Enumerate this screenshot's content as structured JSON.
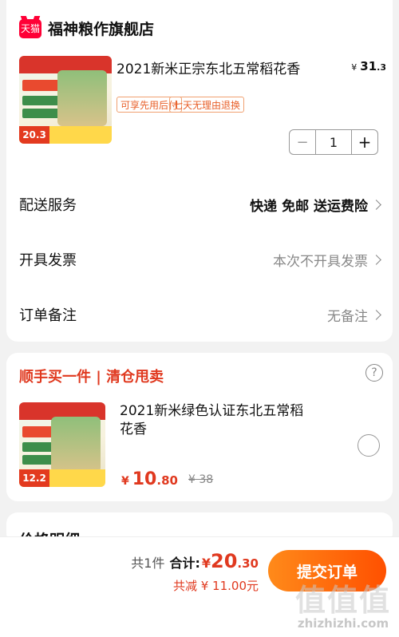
{
  "store": {
    "logo_text": "天猫",
    "name": "福神粮作旗舰店"
  },
  "main_item": {
    "title": "2021新米正宗东北五常稻花香",
    "price_currency": "¥",
    "price_int": "31",
    "price_dec": ".3",
    "image_badge": "20.3",
    "tags": [
      "可享先用后付",
      "七天无理由退换"
    ],
    "quantity": "1",
    "minus_label": "−",
    "plus_label": "+"
  },
  "rows": {
    "delivery": {
      "label": "配送服务",
      "value": "快递 免邮 送运费险"
    },
    "invoice": {
      "label": "开具发票",
      "value": "本次不开具发票"
    },
    "note": {
      "label": "订单备注",
      "value": "无备注"
    }
  },
  "addon": {
    "section_title": "顺手买一件 | 清仓甩卖",
    "help_glyph": "?",
    "title": "2021新米绿色认证东北五常稻花香",
    "price_currency": "¥",
    "price_int": "10",
    "price_dec": ".80",
    "original_price": "¥ 38",
    "image_badge": "12.2"
  },
  "price_detail": {
    "heading": "价格明细"
  },
  "bottom_bar": {
    "count_label": "共1件",
    "total_label": "合计:",
    "total_currency": "¥",
    "total_int": "20",
    "total_dec": ".30",
    "saved_label": "共减 ¥ 11.00元",
    "submit_label": "提交订单"
  },
  "watermark": {
    "glyphs": "值值值",
    "url": "zhizhizhi.com"
  },
  "colors": {
    "accent": "#e0391f",
    "submit_gradient_start": "#ff8a1a",
    "submit_gradient_end": "#ff5000",
    "tmall_red": "#ff0036"
  }
}
